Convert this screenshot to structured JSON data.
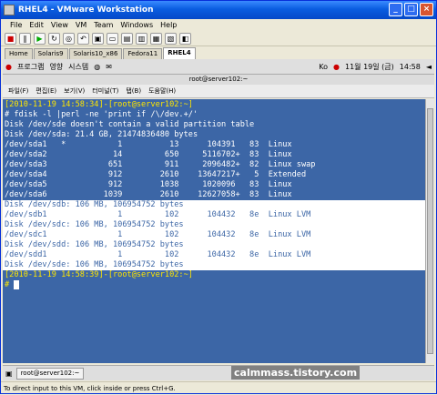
{
  "window": {
    "title": "RHEL4 - VMware Workstation"
  },
  "menu": [
    "File",
    "Edit",
    "View",
    "VM",
    "Team",
    "Windows",
    "Help"
  ],
  "tabs": [
    {
      "label": "Home",
      "active": false
    },
    {
      "label": "Solaris9",
      "active": false
    },
    {
      "label": "Solaris10_x86",
      "active": false
    },
    {
      "label": "Fedora11",
      "active": false
    },
    {
      "label": "RHEL4",
      "active": true
    }
  ],
  "gnome_panel": {
    "programs": "프로그램",
    "places": "영향",
    "system": "시스템",
    "keyboard": "Ko",
    "date": "11월 19일 (금)",
    "time": "14:58"
  },
  "terminal": {
    "title": "root@server102:~",
    "menu": [
      "파일(F)",
      "편집(E)",
      "보기(V)",
      "터미널(T)",
      "탭(B)",
      "도움말(H)"
    ],
    "lines": [
      {
        "text": "[2010-11-19 14:58:34]-[root@server102:~]",
        "highlight": false,
        "yellow": true
      },
      {
        "text": "# fdisk -l |perl -ne 'print if /\\/dev.+/'",
        "highlight": false,
        "yellow": false
      },
      {
        "text": "Disk /dev/sde doesn't contain a valid partition table",
        "highlight": false,
        "yellow": false
      },
      {
        "text": "Disk /dev/sda: 21.4 GB, 21474836480 bytes",
        "highlight": false,
        "yellow": false
      },
      {
        "text": "/dev/sda1   *           1          13      104391   83  Linux",
        "highlight": false,
        "yellow": false
      },
      {
        "text": "/dev/sda2              14         650     5116702+  83  Linux",
        "highlight": false,
        "yellow": false
      },
      {
        "text": "/dev/sda3             651         911     2096482+  82  Linux swap",
        "highlight": false,
        "yellow": false
      },
      {
        "text": "/dev/sda4             912        2610    13647217+   5  Extended",
        "highlight": false,
        "yellow": false
      },
      {
        "text": "/dev/sda5             912        1038     1020096   83  Linux",
        "highlight": false,
        "yellow": false
      },
      {
        "text": "/dev/sda6            1039        2610    12627058+  83  Linux",
        "highlight": false,
        "yellow": false
      },
      {
        "text": "Disk /dev/sdb: 106 MB, 106954752 bytes",
        "highlight": true,
        "yellow": false
      },
      {
        "text": "/dev/sdb1               1         102      104432   8e  Linux LVM",
        "highlight": true,
        "yellow": false
      },
      {
        "text": "Disk /dev/sdc: 106 MB, 106954752 bytes",
        "highlight": true,
        "yellow": false
      },
      {
        "text": "/dev/sdc1               1         102      104432   8e  Linux LVM",
        "highlight": true,
        "yellow": false
      },
      {
        "text": "Disk /dev/sdd: 106 MB, 106954752 bytes",
        "highlight": true,
        "yellow": false
      },
      {
        "text": "/dev/sdd1               1         102      104432   8e  Linux LVM",
        "highlight": true,
        "yellow": false
      },
      {
        "text": "Disk /dev/sde: 106 MB, 106954752 bytes",
        "highlight": true,
        "yellow": false
      },
      {
        "text": "[2010-11-19 14:58:39]-[root@server102:~]",
        "highlight": false,
        "yellow": true
      },
      {
        "text": "# ",
        "highlight": false,
        "yellow": true,
        "cursor": true
      }
    ]
  },
  "taskbar": {
    "item": "root@server102:~"
  },
  "watermark": "calmmass.tistory.com",
  "status": "To direct input to this VM, click inside or press Ctrl+G."
}
